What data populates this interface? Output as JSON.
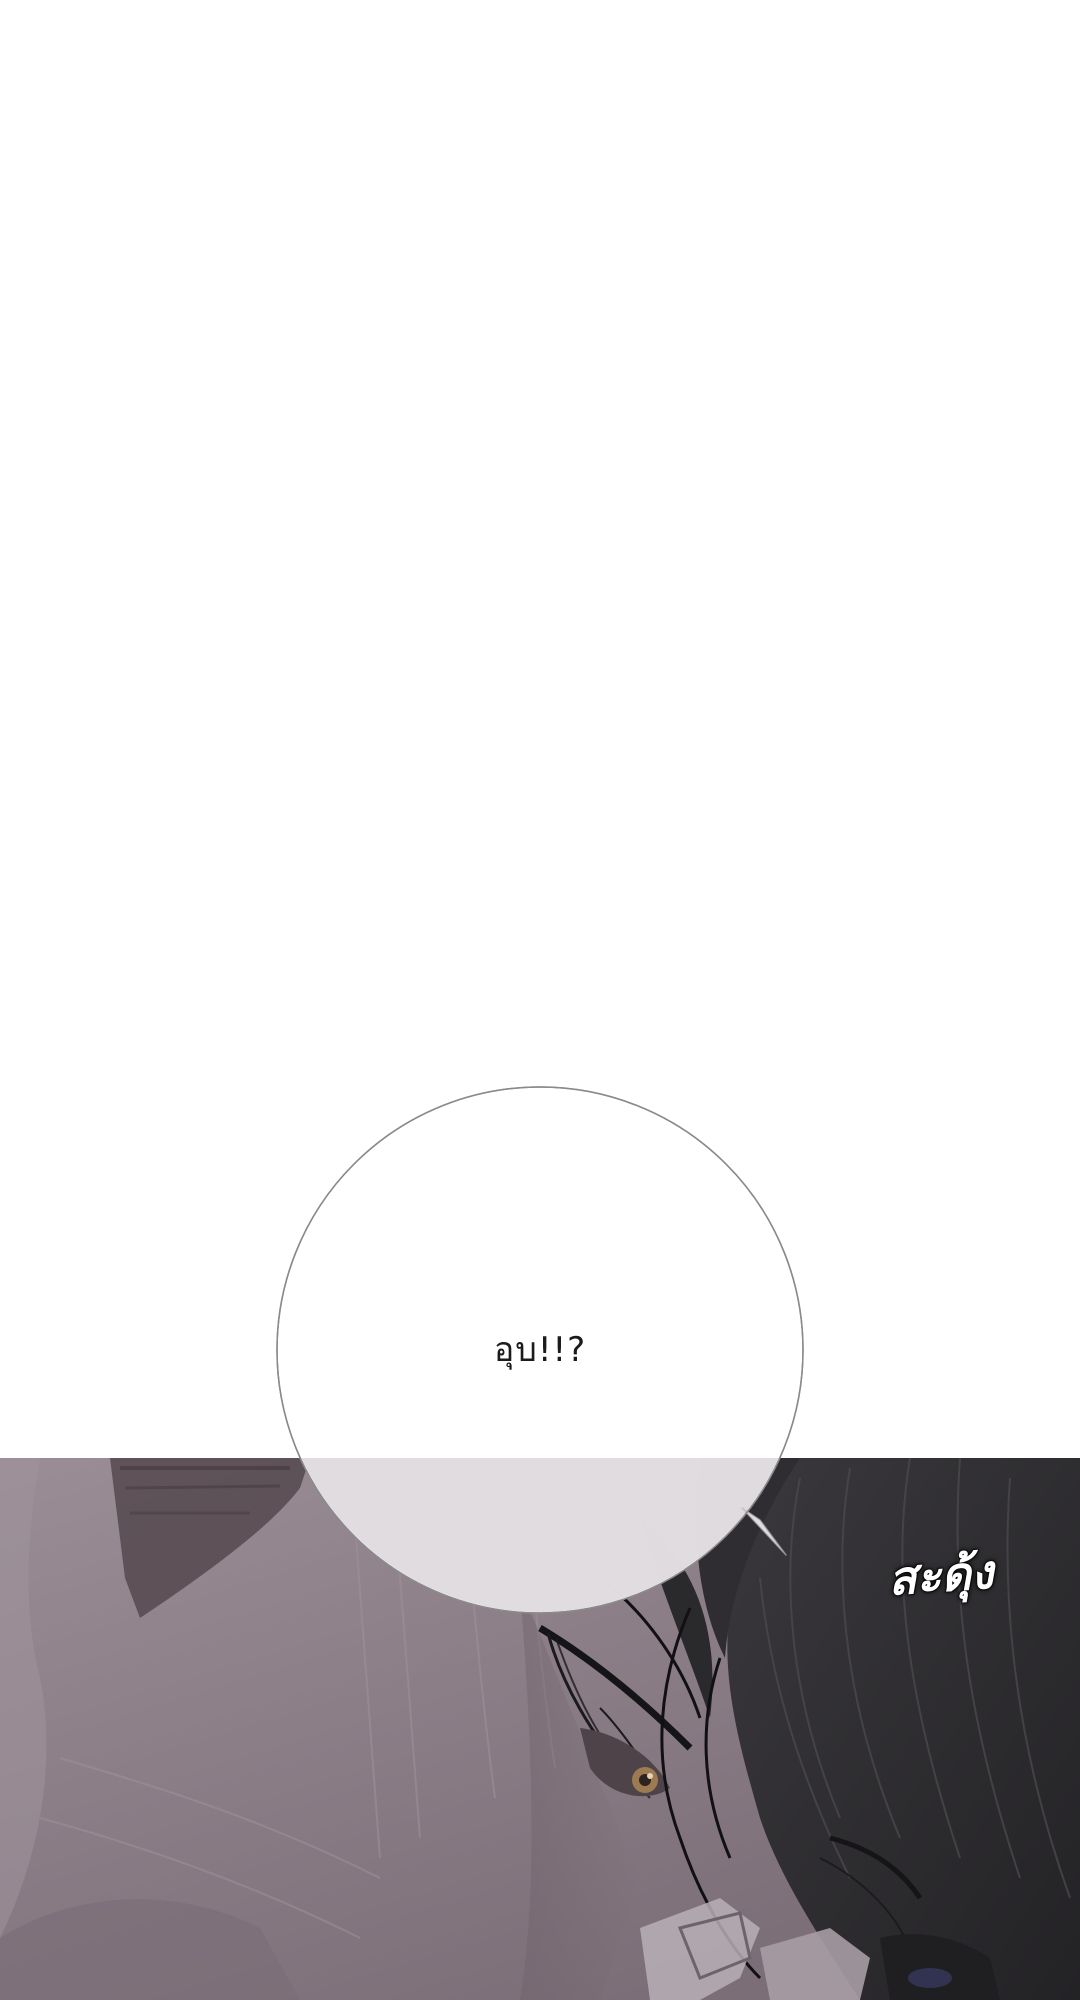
{
  "speech_bubble": {
    "text": "อุบ!!?"
  },
  "sound_effect": {
    "text": "สะดุ้ง"
  },
  "colors": {
    "background": "#ffffff",
    "panel_skin": "#8d8088",
    "panel_hair": "#2c2b2e",
    "bubble_fill": "#ffffff",
    "bubble_stroke": "#8a8a8a"
  }
}
